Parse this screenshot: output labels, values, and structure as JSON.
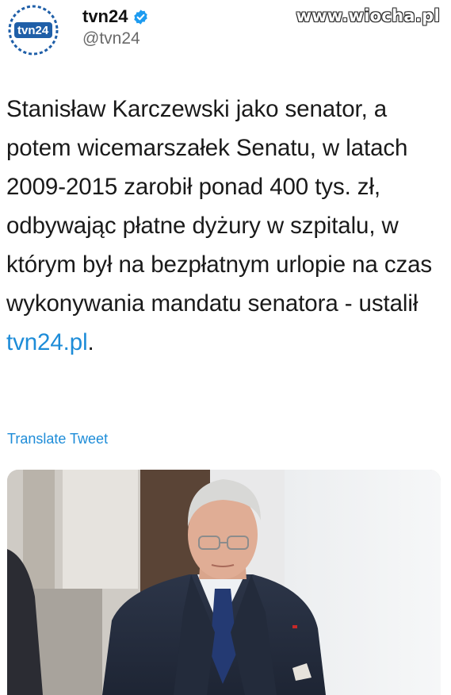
{
  "account": {
    "avatar_icon": "tvn24-logo-icon",
    "avatar_text": "tvn24",
    "display_name": "tvn24",
    "verified_icon": "verified-badge-icon",
    "handle": "@tvn24"
  },
  "watermark": "www.wiocha.pl",
  "tweet": {
    "text": "Stanisław Karczewski jako senator, a potem wicemarszałek Senatu, w latach 2009-2015 zarobił ponad 400 tys. zł, odbywając płatne dyżury w szpitalu, w którym był na bezpłatnym urlopie na czas wykonywania mandatu senatora - ustalił ",
    "link_text": "tvn24.pl",
    "text_end": "."
  },
  "translate_label": "Translate Tweet",
  "media": {
    "kind": "photo",
    "description_icon": "photo-of-man-in-suit"
  },
  "colors": {
    "link": "#1d8cd8",
    "verified": "#1d9bf0",
    "handle": "#6a6a6a"
  }
}
